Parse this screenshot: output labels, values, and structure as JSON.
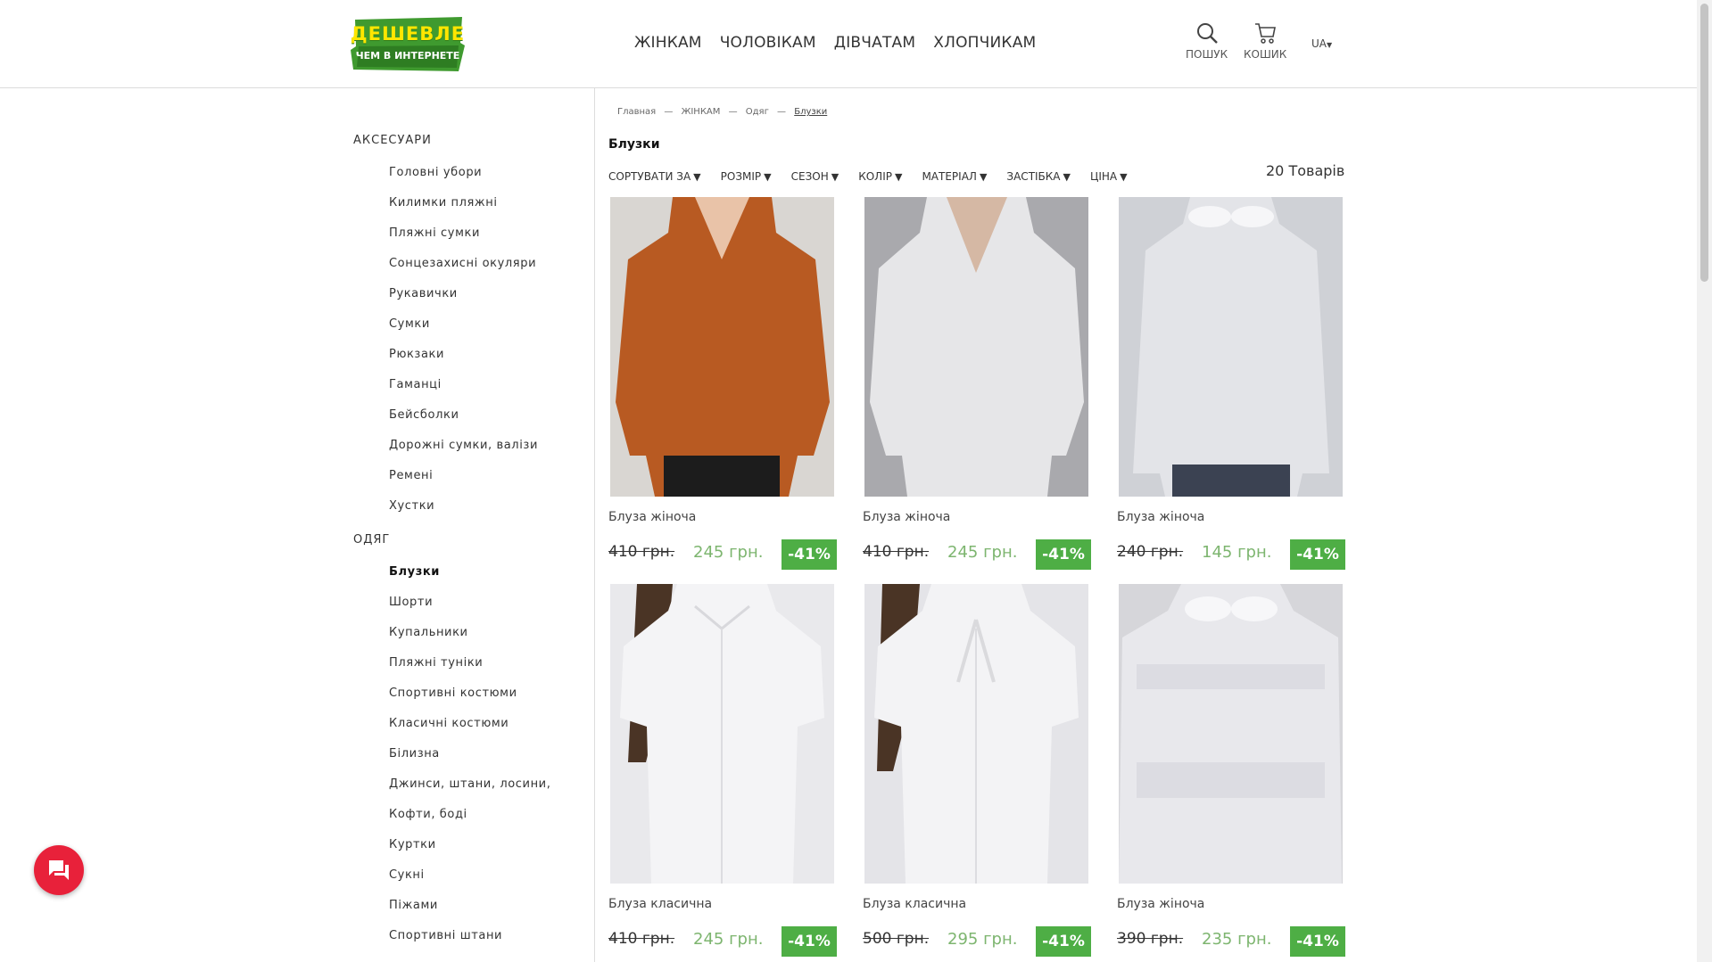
{
  "header": {
    "logo": {
      "line1": "ДЕШЕВЛЕ",
      "line2": "ЧЕМ В ИНТЕРНЕТЕ"
    },
    "nav": [
      "ЖІНКАМ",
      "ЧОЛОВІКАМ",
      "ДІВЧАТАМ",
      "ХЛОПЧИКАМ"
    ],
    "search_label": "ПОШУК",
    "cart_label": "КОШИК",
    "lang": "UA"
  },
  "sidebar": {
    "group1": {
      "title": "АКСЕСУАРИ",
      "items": [
        "Головні убори",
        "Килимки пляжні",
        "Пляжні сумки",
        "Сонцезахисні окуляри",
        "Рукавички",
        "Сумки",
        "Рюкзаки",
        "Гаманці",
        "Бейсболки",
        "Дорожні сумки, валізи",
        "Ремені",
        "Хустки"
      ]
    },
    "group2": {
      "title": "ОДЯГ",
      "items": [
        "Блузки",
        "Шорти",
        "Купальники",
        "Пляжні туніки",
        "Спортивні костюми",
        "Класичні костюми",
        "Білизна",
        "Джинси, штани, лосини,",
        "Кофти, боді",
        "Куртки",
        "Сукні",
        "Піжами",
        "Спортивні штани"
      ]
    }
  },
  "breadcrumb": [
    "Главная",
    "—",
    "ЖІНКАМ",
    "—",
    "Одяг",
    "—",
    "Блузки"
  ],
  "page_title": "Блузки",
  "filters": [
    "СОРТУВАТИ ЗА",
    "РОЗМІР",
    "СЕЗОН",
    "КОЛІР",
    "МАТЕРІАЛ",
    "ЗАСТІБКА",
    "ЦІНА"
  ],
  "filter_arrow": "▼",
  "product_count": "20 Товарів",
  "products": [
    {
      "name": "Блуза жіноча",
      "old_price": "410 грн.",
      "new_price": "245 грн.",
      "discount": "-41%",
      "color": "#b85a22"
    },
    {
      "name": "Блуза жіноча",
      "old_price": "410 грн.",
      "new_price": "245 грн.",
      "discount": "-41%",
      "color": "#e6e6e8"
    },
    {
      "name": "Блуза жіноча",
      "old_price": "240 грн.",
      "new_price": "145 грн.",
      "discount": "-41%",
      "color": "#e3e4e8"
    },
    {
      "name": "Блуза класична",
      "old_price": "410 грн.",
      "new_price": "245 грн.",
      "discount": "-41%",
      "color": "#f4f4f6"
    },
    {
      "name": "Блуза класична",
      "old_price": "500 грн.",
      "new_price": "295 грн.",
      "discount": "-41%",
      "color": "#f3f3f5"
    },
    {
      "name": "Блуза жіноча",
      "old_price": "390 грн.",
      "new_price": "235 грн.",
      "discount": "-41%",
      "color": "#e8e8ec"
    }
  ],
  "colors": {
    "accent_green": "#4eae45",
    "price_green": "#7db56f",
    "chat_red": "#e8213a"
  }
}
